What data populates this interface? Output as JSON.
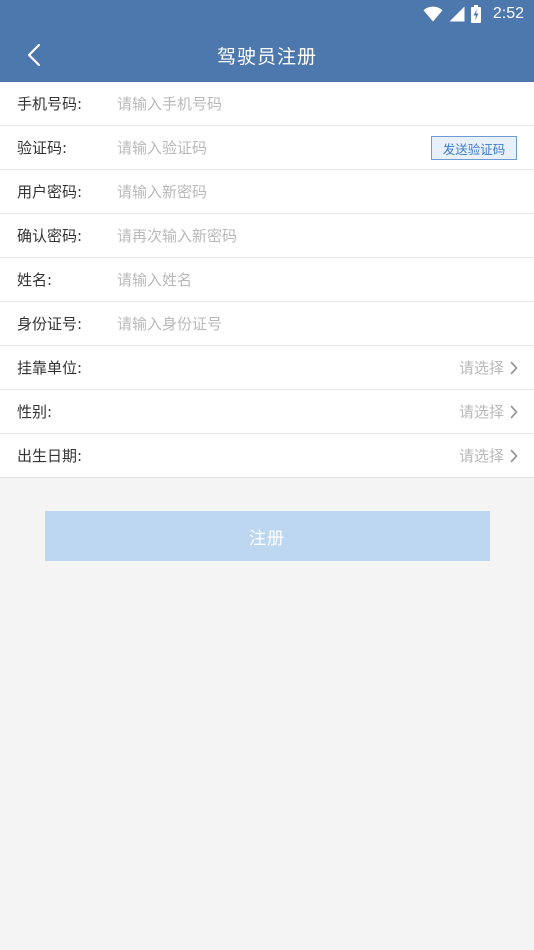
{
  "status_bar": {
    "time": "2:52"
  },
  "app_bar": {
    "title": "驾驶员注册"
  },
  "form": {
    "fields": [
      {
        "label": "手机号码:",
        "placeholder": "请输入手机号码"
      },
      {
        "label": "验证码:",
        "placeholder": "请输入验证码",
        "button": "发送验证码"
      },
      {
        "label": "用户密码:",
        "placeholder": "请输入新密码"
      },
      {
        "label": "确认密码:",
        "placeholder": "请再次输入新密码"
      },
      {
        "label": "姓名:",
        "placeholder": "请输入姓名"
      },
      {
        "label": "身份证号:",
        "placeholder": "请输入身份证号"
      },
      {
        "label": "挂靠单位:",
        "select": "请选择"
      },
      {
        "label": "性别:",
        "select": "请选择"
      },
      {
        "label": "出生日期:",
        "select": "请选择"
      }
    ]
  },
  "submit": {
    "label": "注册"
  },
  "colors": {
    "primary": "#4d78ad",
    "submit_disabled": "#bcd7ef",
    "code_button_border": "#6e9bd3",
    "background": "#f4f4f4"
  },
  "icons": {
    "back": "back-arrow-icon",
    "select": "chevron-right-icon",
    "wifi": "wifi-icon",
    "signal": "cell-signal-icon",
    "battery": "battery-charging-icon"
  }
}
